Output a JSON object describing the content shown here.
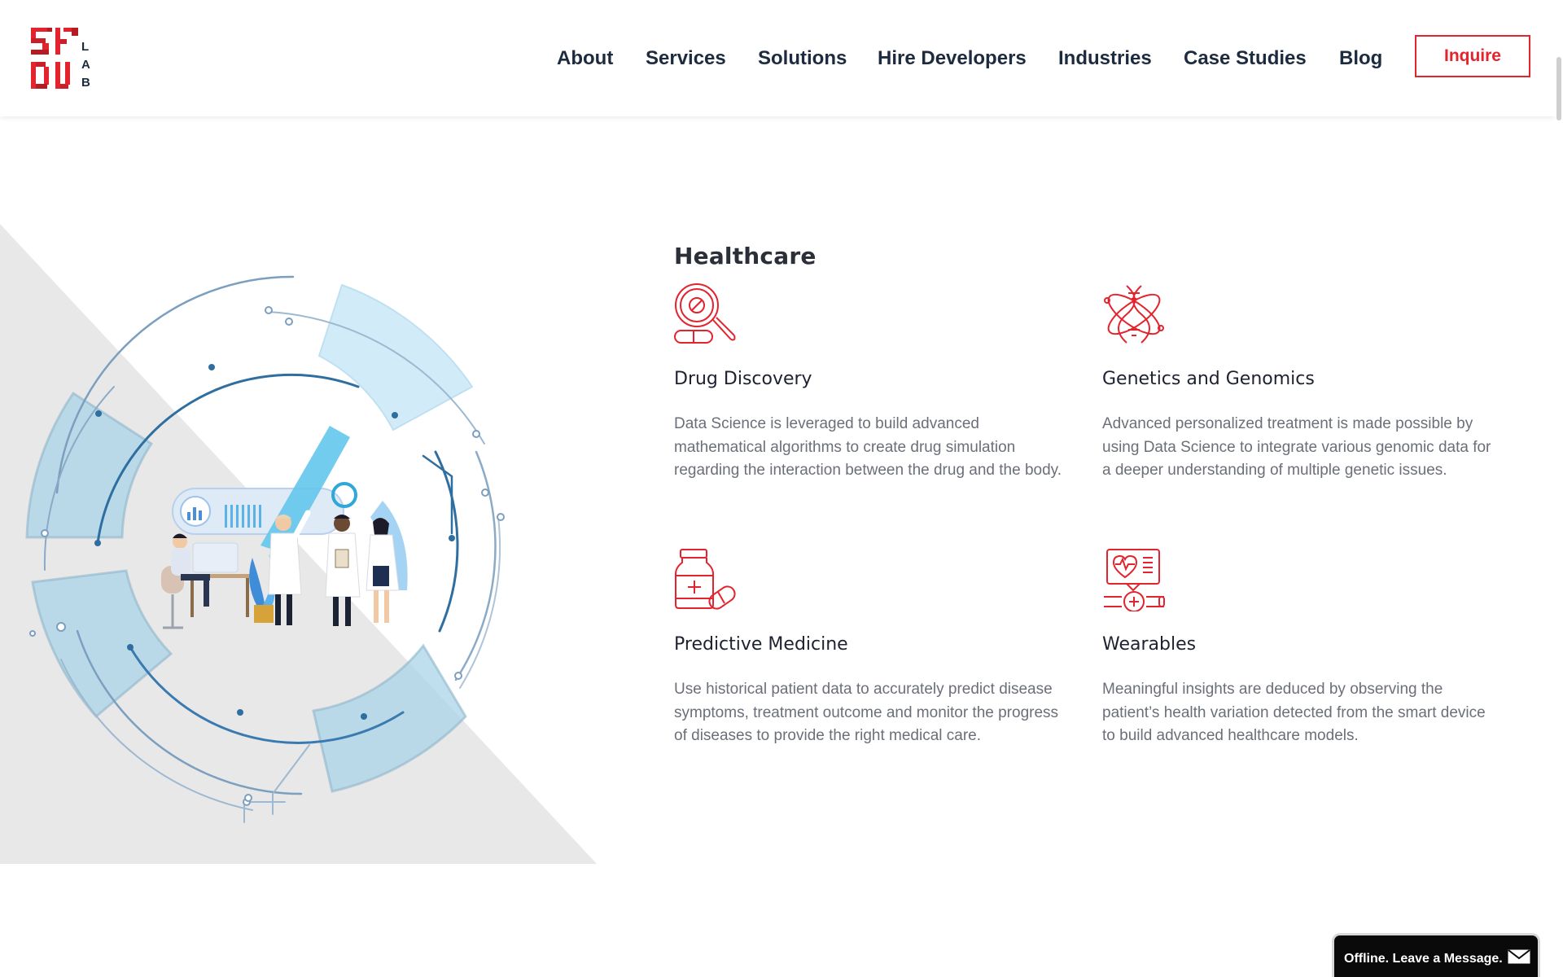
{
  "brand": {
    "logo_text": "SDLC LAB",
    "accent": "#e3232d",
    "dark": "#1d2b3f"
  },
  "nav": {
    "items": [
      {
        "label": "About"
      },
      {
        "label": "Services"
      },
      {
        "label": "Solutions"
      },
      {
        "label": "Hire Developers"
      },
      {
        "label": "Industries"
      },
      {
        "label": "Case Studies"
      },
      {
        "label": "Blog"
      }
    ],
    "cta": "Inquire"
  },
  "section": {
    "title": "Healthcare",
    "cards": [
      {
        "icon": "magnifier-pill-icon",
        "title": "Drug Discovery",
        "desc": "Data Science is leveraged to build advanced mathematical algorithms to create drug simulation regarding the interaction between the drug and the body."
      },
      {
        "icon": "dna-atom-icon",
        "title": "Genetics and Genomics",
        "desc": "Advanced personalized treatment is made possible by using Data Science to integrate various genomic data for a deeper understanding of multiple genetic issues."
      },
      {
        "icon": "medicine-bottle-icon",
        "title": "Predictive Medicine",
        "desc": "Use historical patient data to accurately predict disease symptoms, treatment outcome and monitor the progress of diseases to provide the right medical care."
      },
      {
        "icon": "smartwatch-health-icon",
        "title": "Wearables",
        "desc": "Meaningful insights are deduced by observing the patient’s health variation detected from the smart device to build advanced healthcare models."
      }
    ]
  },
  "chat": {
    "label": "Offline. Leave a Message.",
    "icon": "envelope-icon"
  }
}
